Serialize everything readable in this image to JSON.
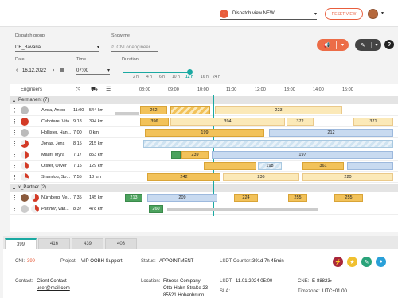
{
  "header": {
    "dispatch_view": "Dispatch view NEW",
    "reset_view": "RESET VIEW"
  },
  "filters": {
    "dispatch_group_label": "Dispatch group",
    "dispatch_group_value": "DE_Bavaria",
    "show_me_label": "Show me",
    "search_placeholder": "CNI or engineer",
    "date_label": "Date",
    "date_value": "16.12.2022",
    "time_label": "Time",
    "time_value": "07:00",
    "duration_label": "Duration",
    "durations": [
      "2 h",
      "4 h",
      "6 h",
      "10 h",
      "12 h",
      "16 h",
      "24 h"
    ],
    "duration_selected": "12 h"
  },
  "table": {
    "engineers_header": "Engineers",
    "timeline_ticks": [
      "08:00",
      "09:00",
      "10:00",
      "11:00",
      "12:00",
      "13:00",
      "14:00",
      "15:00"
    ],
    "groups": [
      {
        "label": "Permanent (7)",
        "rows": [
          {
            "name": "Amra, Anton",
            "time": "11:00",
            "km": "544 km",
            "status_color": "#bbbbbb",
            "bars": [
              {
                "label": "262"
              },
              {
                "label": "223"
              }
            ]
          },
          {
            "name": "Cebotare, Vita",
            "time": "9:18",
            "km": "394 km",
            "status_color": "#d33a26",
            "bars": [
              {
                "label": "396"
              },
              {
                "label": "394"
              },
              {
                "label": "372"
              },
              {
                "label": "371"
              }
            ]
          },
          {
            "name": "Hollister, Han...",
            "time": "7:00",
            "km": "0 km",
            "status_color": "#bbbbbb",
            "bars": [
              {
                "label": "199"
              },
              {
                "label": "212"
              }
            ]
          },
          {
            "name": "Jonas, Jens",
            "time": "8:15",
            "km": "215 km",
            "status_color": "#d33a26",
            "bars": []
          },
          {
            "name": "Mauri, Myra",
            "time": "7:17",
            "km": "853 km",
            "status_color": "#d33a26",
            "bars": [
              {
                "label": "239"
              },
              {
                "label": "197"
              }
            ]
          },
          {
            "name": "Olster, Oliver",
            "time": "7:15",
            "km": "129 km",
            "status_color": "#d33a26",
            "bars": [
              {
                "label": "198"
              },
              {
                "label": "361"
              }
            ]
          },
          {
            "name": "Shamlou, So...",
            "time": "7:55",
            "km": "18 km",
            "status_color": "#d33a26",
            "bars": [
              {
                "label": "242"
              },
              {
                "label": "236"
              },
              {
                "label": "220"
              }
            ]
          }
        ]
      },
      {
        "label": "x_Partner (2)",
        "rows": [
          {
            "name": "Nürnberg, Ve...",
            "time": "7:35",
            "km": "145 km",
            "status_color": "#d33a26",
            "bars": [
              {
                "label": "213"
              },
              {
                "label": "209"
              },
              {
                "label": "224"
              },
              {
                "label": "255"
              },
              {
                "label": "255"
              }
            ]
          },
          {
            "name": "Partner, Van...",
            "time": "8:37",
            "km": "478 km",
            "status_color": "#d33a26",
            "bars": [
              {
                "label": "260"
              }
            ]
          }
        ]
      }
    ]
  },
  "tabs": [
    "399",
    "416",
    "439",
    "403"
  ],
  "details": {
    "cni_label": "CNI:",
    "cni_value": "399",
    "project_label": "Project:",
    "project_value": "VIP OOBH Support",
    "status_label": "Status:",
    "status_value": "APPOINTMENT",
    "lsdt_counter_label": "LSDT Counter:",
    "lsdt_counter_value": "391d 7h 45min",
    "contact_label": "Contact:",
    "contact_value": "Client Contact",
    "contact_email": "user@mail.com",
    "location_label": "Location:",
    "location_line1": "Fitness Company",
    "location_line2": "Otto-Hahn-Straße 23",
    "location_line3": "85521 Hohenbrunn",
    "lsdt_label": "LSDT:",
    "lsdt_value": "11.01.2024 05:00",
    "sla_label": "SLA:",
    "cne_label": "CNE:",
    "cne_value": "E-88823",
    "timezone_label": "Timezone:",
    "timezone_value": "UTC+01:00"
  }
}
